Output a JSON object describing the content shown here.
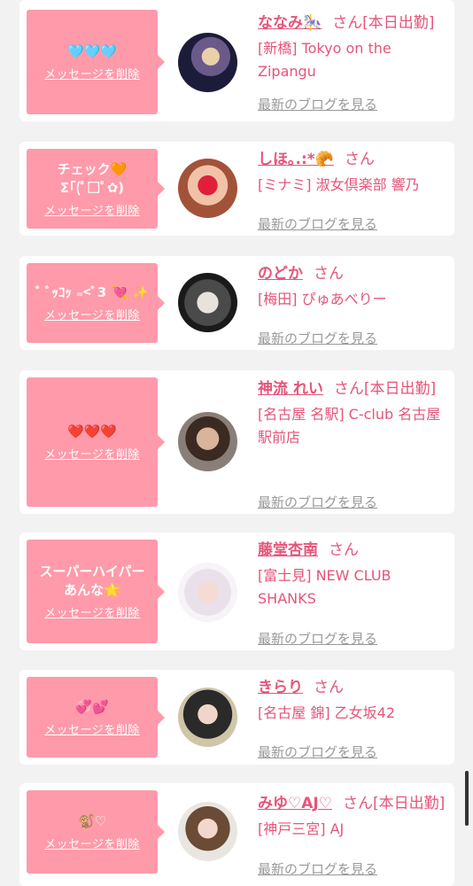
{
  "items": [
    {
      "message": "🩵🩵🩵",
      "delete_label": "メッセージを削除",
      "name": "ななみ🎠",
      "san": "さん",
      "status": "[本日出勤]",
      "shop": "[新橋] Tokyo on the Zipangu",
      "blog": "最新のブログを見る",
      "avatar_icon": "avatar-photo"
    },
    {
      "message": "チェック🧡\nΣ｢(ﾟ□ﾟ✿)",
      "delete_label": "メッセージを削除",
      "name": "しほ｡.:*🥐",
      "san": "さん",
      "status": "",
      "shop": "[ミナミ] 淑女倶楽部 響乃",
      "blog": "最新のブログを見る",
      "avatar_icon": "avatar-photo"
    },
    {
      "message": "ﾞ ﾞｯｺｯ ₌<ﾞ3 💘 ✨",
      "delete_label": "メッセージを削除",
      "name": "のどか",
      "san": "さん",
      "status": "",
      "shop": "[梅田] ぴゅあべりー",
      "blog": "最新のブログを見る",
      "avatar_icon": "avatar-photo"
    },
    {
      "message": "❤️❤️❤️",
      "delete_label": "メッセージを削除",
      "name": "神流 れい",
      "san": "さん",
      "status": "[本日出勤]",
      "shop": "[名古屋 名駅] C-club 名古屋駅前店",
      "blog": "最新のブログを見る",
      "avatar_icon": "avatar-photo"
    },
    {
      "message": "スーパーハイパー\nあんな🌟",
      "delete_label": "メッセージを削除",
      "name": "藤堂杏南",
      "san": "さん",
      "status": "",
      "shop": "[富士見] NEW CLUB SHANKS",
      "blog": "最新のブログを見る",
      "avatar_icon": "avatar-photo"
    },
    {
      "message": "💞💕",
      "delete_label": "メッセージを削除",
      "name": "きらり",
      "san": "さん",
      "status": "",
      "shop": "[名古屋 錦] 乙女坂42",
      "blog": "最新のブログを見る",
      "avatar_icon": "avatar-photo"
    },
    {
      "message": "🐒♡",
      "delete_label": "メッセージを削除",
      "name": "みゆ♡AJ♡",
      "san": "さん",
      "status": "[本日出勤]",
      "shop": "[神戸三宮] AJ",
      "blog": "最新のブログを見る",
      "avatar_icon": "avatar-photo"
    }
  ],
  "colors": {
    "accent": "#e5557a",
    "bubble": "#ff9aaa",
    "muted": "#999999",
    "background": "#f2f2f2"
  }
}
